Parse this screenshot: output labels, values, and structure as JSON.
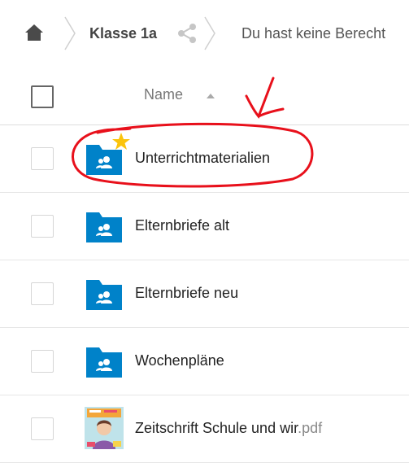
{
  "breadcrumb": {
    "home_icon": "home-icon",
    "current": "Klasse 1a",
    "share_icon": "share-icon",
    "notice": "Du hast keine Berecht"
  },
  "table": {
    "name_header": "Name",
    "sort_icon": "sort-ascending-icon",
    "rows": [
      {
        "name": "Unterrichtmaterialien",
        "ext": "",
        "icon": "shared-folder-icon",
        "favorite": true
      },
      {
        "name": "Elternbriefe alt",
        "ext": "",
        "icon": "shared-folder-icon",
        "favorite": false
      },
      {
        "name": "Elternbriefe neu",
        "ext": "",
        "icon": "shared-folder-icon",
        "favorite": false
      },
      {
        "name": "Wochenpläne",
        "ext": "",
        "icon": "shared-folder-icon",
        "favorite": false
      },
      {
        "name": "Zeitschrift Schule und wir",
        "ext": ".pdf",
        "icon": "pdf-thumbnail-icon",
        "favorite": false
      }
    ]
  },
  "colors": {
    "folder_blue": "#0082c9",
    "star_yellow": "#fbc40c",
    "annotation_red": "#e8101b"
  }
}
